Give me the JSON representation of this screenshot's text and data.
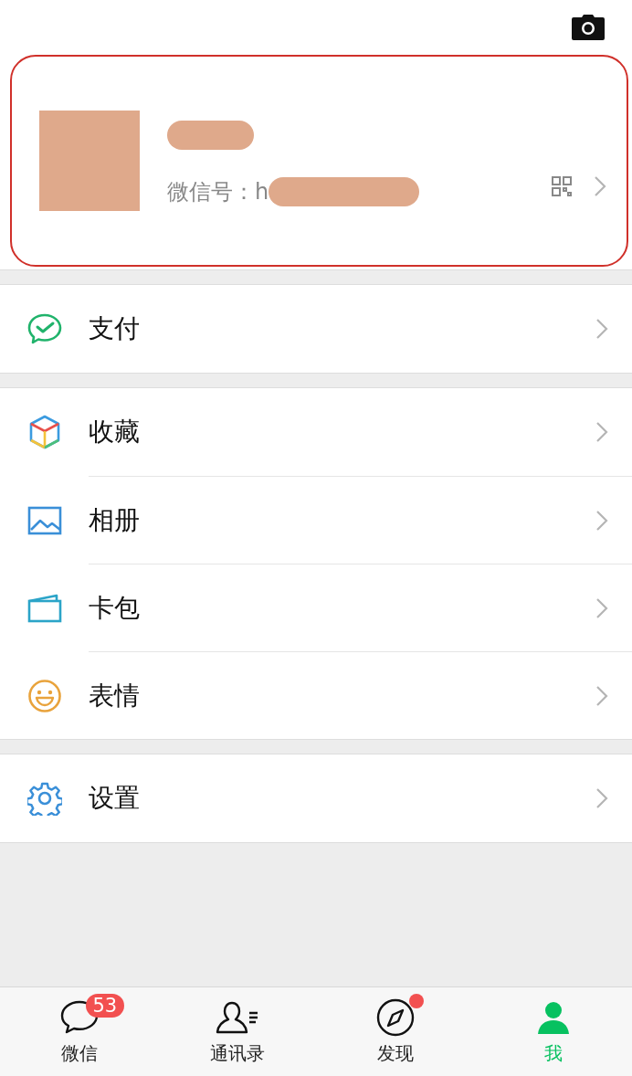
{
  "profile": {
    "highlighted": true,
    "id_label": "微信号：h"
  },
  "sections": [
    {
      "items": [
        {
          "label": "支付",
          "kind": "pay"
        }
      ]
    },
    {
      "items": [
        {
          "label": "收藏",
          "kind": "favorites"
        },
        {
          "label": "相册",
          "kind": "album"
        },
        {
          "label": "卡包",
          "kind": "cards"
        },
        {
          "label": "表情",
          "kind": "emoji"
        }
      ]
    },
    {
      "items": [
        {
          "label": "设置",
          "kind": "settings"
        }
      ]
    }
  ],
  "tabs": [
    {
      "label": "微信",
      "kind": "chat",
      "badge": "53",
      "dot": false,
      "selected": false
    },
    {
      "label": "通讯录",
      "kind": "contacts",
      "dot": false,
      "selected": false
    },
    {
      "label": "发现",
      "kind": "discover",
      "dot": true,
      "selected": false
    },
    {
      "label": "我",
      "kind": "me",
      "dot": false,
      "selected": true
    }
  ]
}
